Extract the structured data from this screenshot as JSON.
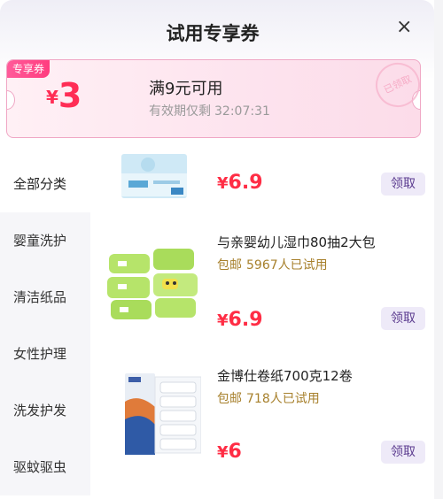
{
  "header": {
    "title": "试用专享券",
    "close_symbol": "×"
  },
  "coupon": {
    "tag": "专享券",
    "currency": "¥",
    "amount": "3",
    "condition": "满9元可用",
    "expiry_label": "有效期仅剩",
    "expiry_time": "32:07:31",
    "stamp": "已领取"
  },
  "sidebar": {
    "items": [
      {
        "label": "全部分类"
      },
      {
        "label": "婴童洗护"
      },
      {
        "label": "清洁纸品"
      },
      {
        "label": "女性护理"
      },
      {
        "label": "洗发护发"
      },
      {
        "label": "驱蚊驱虫"
      }
    ]
  },
  "products": [
    {
      "name": "",
      "shipping": "",
      "tried": "",
      "currency": "¥",
      "price": "6.9",
      "claim": "领取"
    },
    {
      "name": "与亲婴幼儿湿巾80抽2大包",
      "shipping": "包邮",
      "tried": "5967人已试用",
      "currency": "¥",
      "price": "6.9",
      "claim": "领取"
    },
    {
      "name": "金博仕卷纸700克12卷",
      "shipping": "包邮",
      "tried": "718人已试用",
      "currency": "¥",
      "price": "6",
      "claim": "领取"
    }
  ],
  "colors": {
    "price": "#ff2d45",
    "accent": "#ff3d7f",
    "claim_text": "#5b3b8f",
    "claim_bg": "#eeeaf8",
    "meta": "#a7802c"
  },
  "icons": [
    "close-icon",
    "coupon-stamp-icon"
  ]
}
